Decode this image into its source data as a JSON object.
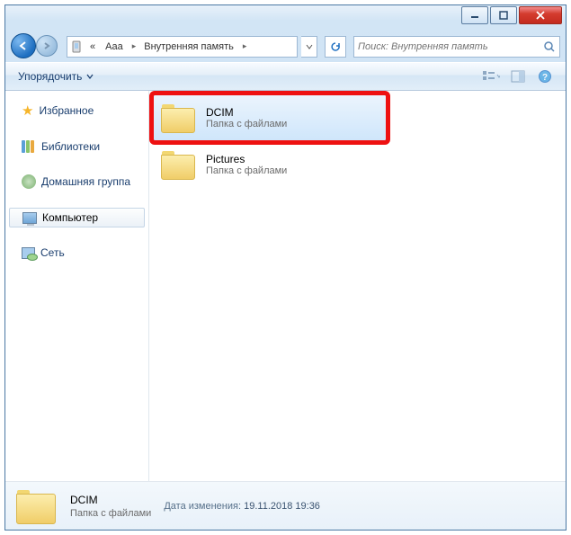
{
  "breadcrumb": {
    "root_glyph": "«",
    "seg1": "Aaa",
    "seg2": "Внутренняя память"
  },
  "search": {
    "placeholder": "Поиск: Внутренняя память"
  },
  "toolbar": {
    "organize": "Упорядочить"
  },
  "sidebar": {
    "favorites": "Избранное",
    "libraries": "Библиотеки",
    "homegroup": "Домашняя группа",
    "computer": "Компьютер",
    "network": "Сеть"
  },
  "folders": [
    {
      "name": "DCIM",
      "type": "Папка с файлами",
      "selected": true,
      "highlighted": true
    },
    {
      "name": "Pictures",
      "type": "Папка с файлами",
      "selected": false,
      "highlighted": false
    }
  ],
  "details": {
    "name": "DCIM",
    "type": "Папка с файлами",
    "date_label": "Дата изменения:",
    "date_value": "19.11.2018 19:36"
  }
}
